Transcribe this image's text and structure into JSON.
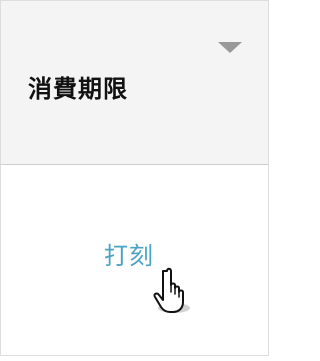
{
  "table": {
    "header": {
      "title": "消費期限",
      "sort_icon": "caret-down-icon"
    },
    "row": {
      "action_label": "打刻"
    }
  },
  "colors": {
    "header_background": "#f4f4f4",
    "border": "#dddddd",
    "link": "#4aa3c3",
    "sort_icon": "#999999"
  },
  "cursor": {
    "icon": "hand-pointer-icon"
  }
}
